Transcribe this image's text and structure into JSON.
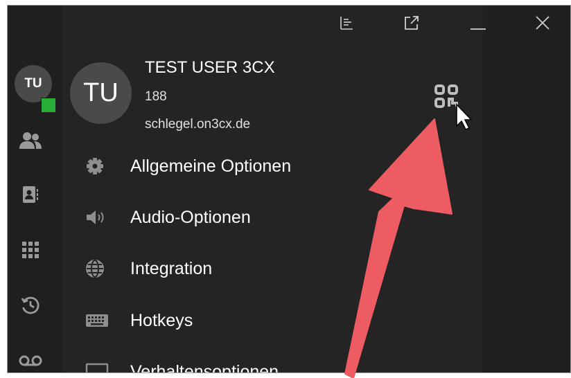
{
  "titlebar": {
    "buttons": [
      {
        "icon": "chart-icon"
      },
      {
        "icon": "popout-icon"
      },
      {
        "icon": "minimize-icon"
      },
      {
        "icon": "close-icon"
      }
    ]
  },
  "sidebar": {
    "avatar_initials": "TU",
    "status_color": "#27ae39",
    "items": [
      {
        "icon": "contacts-icon"
      },
      {
        "icon": "address-book-icon"
      },
      {
        "icon": "dialpad-icon"
      },
      {
        "icon": "history-icon"
      },
      {
        "icon": "voicemail-icon"
      }
    ]
  },
  "profile": {
    "initials": "TU",
    "name": "TEST USER 3CX",
    "extension": "188",
    "host": "schlegel.on3cx.de",
    "qr_icon": "qr-code-icon"
  },
  "menu": {
    "items": [
      {
        "label": "Allgemeine Optionen",
        "icon": "gear-icon"
      },
      {
        "label": "Audio-Optionen",
        "icon": "speaker-icon"
      },
      {
        "label": "Integration",
        "icon": "globe-icon"
      },
      {
        "label": "Hotkeys",
        "icon": "keyboard-icon"
      },
      {
        "label": "Verhaltensoptionen",
        "icon": "monitor-icon"
      }
    ]
  },
  "annotation": {
    "arrow_color": "#ee5c63",
    "cursor_icon": "mouse-pointer-icon"
  }
}
